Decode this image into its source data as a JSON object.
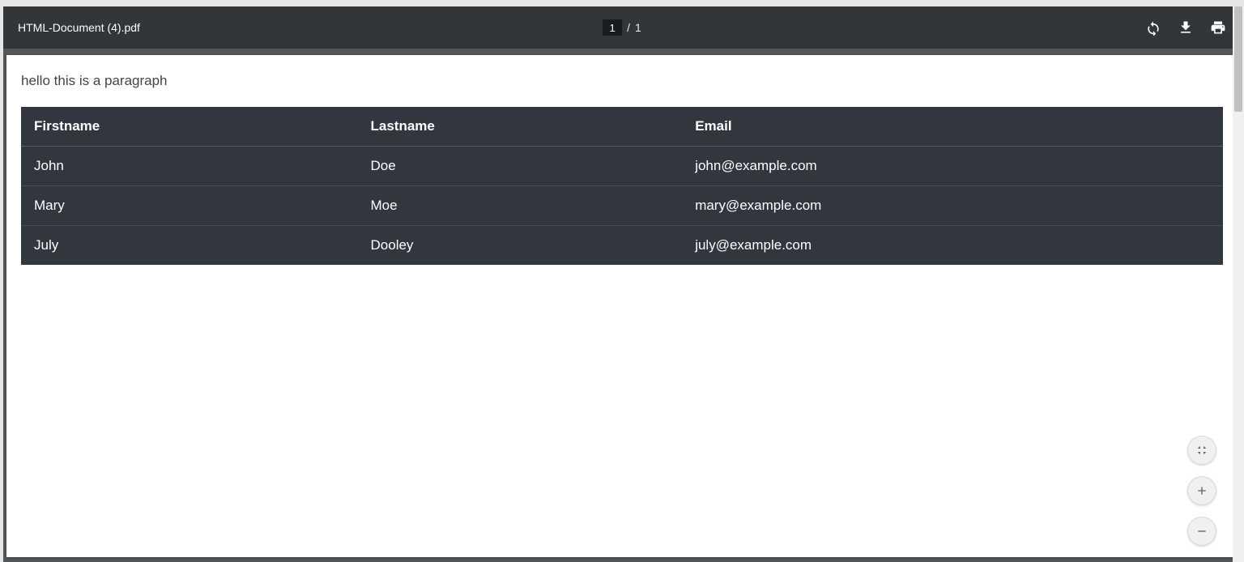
{
  "toolbar": {
    "title": "HTML-Document (4).pdf",
    "page_current": "1",
    "page_slash": "/",
    "page_total": "1"
  },
  "document": {
    "paragraph": "hello this is a paragraph",
    "table": {
      "headers": [
        "Firstname",
        "Lastname",
        "Email"
      ],
      "rows": [
        [
          "John",
          "Doe",
          "john@example.com"
        ],
        [
          "Mary",
          "Moe",
          "mary@example.com"
        ],
        [
          "July",
          "Dooley",
          "july@example.com"
        ]
      ]
    }
  },
  "icons": {
    "rotate": "rotate-icon",
    "download": "download-icon",
    "print": "print-icon",
    "fit": "fit-page-icon",
    "zoom_in": "zoom-in-icon",
    "zoom_out": "zoom-out-icon"
  }
}
